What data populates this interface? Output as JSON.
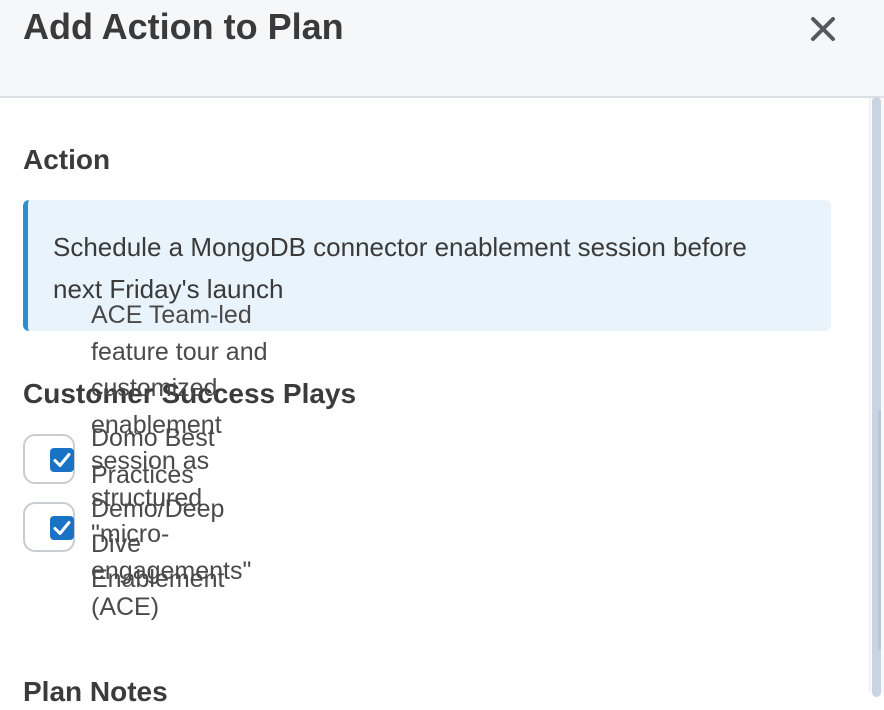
{
  "dialog": {
    "title": "Add Action to Plan",
    "close_icon": "close-icon"
  },
  "action": {
    "label": "Action",
    "text": "Schedule a MongoDB connector enablement session before next Friday's launch"
  },
  "plays": {
    "label": "Customer Success Plays",
    "overflow_description": "ACE Team-led feature tour and customized enablement session as structured \"micro-engagements\" (ACE)",
    "items": [
      {
        "label": "Domo Best Practices",
        "checked": true
      },
      {
        "label": "Demo/Deep Dive Enablement",
        "checked": true
      }
    ]
  },
  "notes": {
    "label": "Plan Notes"
  },
  "colors": {
    "accent": "#1a72c5",
    "action_border": "#2a8fd0",
    "action_bg": "#e8f3fb",
    "header_bg": "#f6f7f9"
  }
}
